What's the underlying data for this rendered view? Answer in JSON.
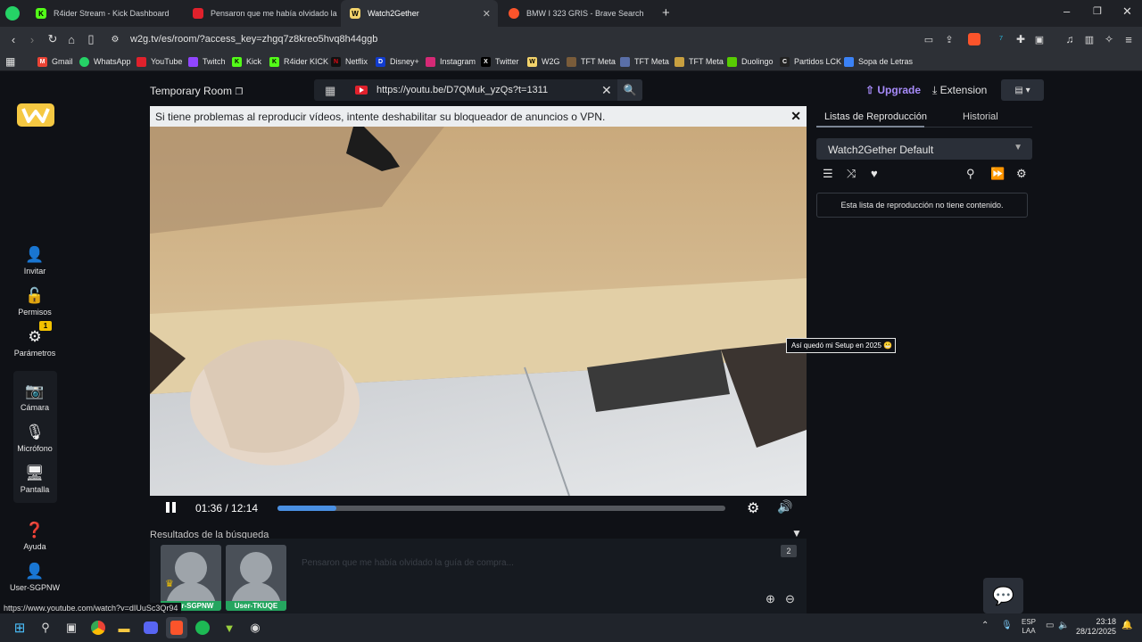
{
  "browser": {
    "tabs": [
      {
        "label": "R4ider Stream - Kick Dashboard",
        "active": false
      },
      {
        "label": "Pensaron que me había olvidado la guía",
        "active": false
      },
      {
        "label": "Watch2Gether",
        "active": true
      },
      {
        "label": "BMW I 323 GRIS - Brave Search",
        "active": false
      }
    ],
    "url": "w2g.tv/es/room/?access_key=zhgq7z8kreo5hvq8h44ggb",
    "bookmarks": [
      "Gmail",
      "WhatsApp",
      "YouTube",
      "Twitch",
      "Kick",
      "R4ider KICK",
      "Netflix",
      "Disney+",
      "Instagram",
      "Twitter",
      "W2G",
      "TFT Meta",
      "TFT Meta",
      "TFT Meta",
      "Duolingo",
      "Partidos LCK",
      "Sopa de Letras"
    ]
  },
  "sidebar": {
    "items": [
      {
        "label": "Invitar"
      },
      {
        "label": "Permisos"
      },
      {
        "label": "Parámetros",
        "badge": "1"
      },
      {
        "label": "Cámara"
      },
      {
        "label": "Micrófono"
      },
      {
        "label": "Pantalla"
      },
      {
        "label": "Ayuda"
      },
      {
        "label": "User-SGPNW"
      }
    ]
  },
  "room": {
    "title": "Temporary Room",
    "search_value": "https://youtu.be/D7QMuk_yzQs?t=1311",
    "upgrade": "Upgrade",
    "extension": "Extension",
    "notice": "Si tiene problemas al reproducir vídeos, intente deshabilitar su bloqueador de anuncios o VPN.",
    "time": "01:36 / 12:14",
    "progress": 0.131,
    "tooltip": "Así quedó mi Setup en 2025 😬",
    "results_label": "Resultados de la búsqueda",
    "chat_placeholder": "Pensaron que me había olvidado la guía de compra...",
    "user_count": "2",
    "users": [
      "User-SGPNW",
      "User-TKUQE"
    ]
  },
  "playlist": {
    "tab_active": "Listas de Reproducción",
    "tab_other": "Historial",
    "selected": "Watch2Gether Default",
    "empty_message": "Esta lista de reproducción no tiene contenido."
  },
  "status_url": "https://www.youtube.com/watch?v=dIUuSc3Qr94",
  "taskbar": {
    "lang_top": "ESP",
    "lang_bottom": "LAA",
    "time": "23:18",
    "date": "28/12/2025"
  },
  "colors": {
    "accent": "#4a90e2",
    "upgrade": "#a78bfa",
    "user_green": "#25a55f",
    "youtube_red": "#e0212c",
    "badge_yellow": "#f2c200"
  }
}
